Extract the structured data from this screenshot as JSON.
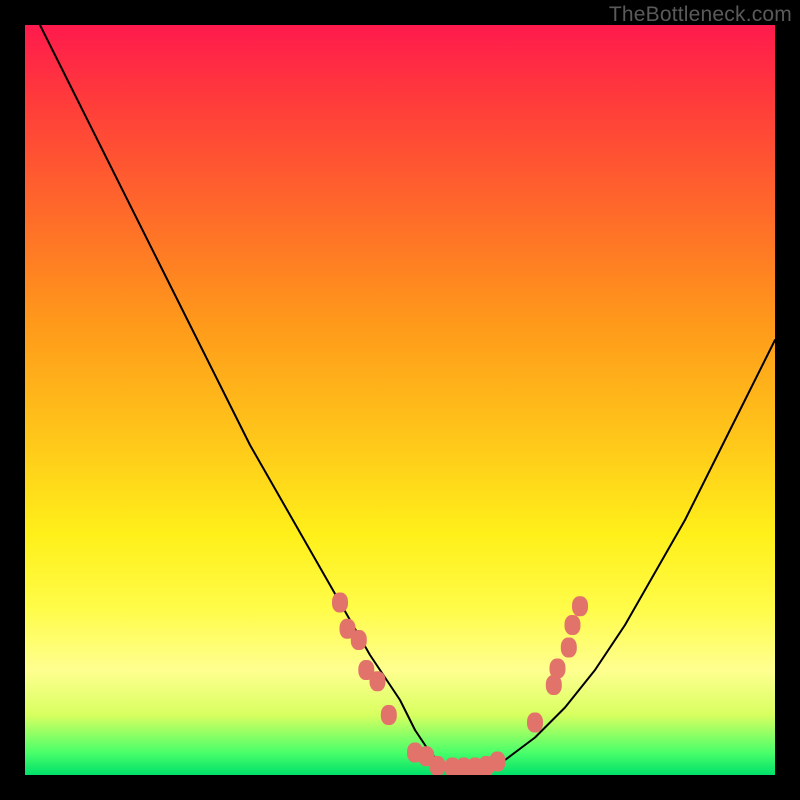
{
  "watermark": "TheBottleneck.com",
  "chart_data": {
    "type": "line",
    "title": "",
    "xlabel": "",
    "ylabel": "",
    "xlim": [
      0,
      100
    ],
    "ylim": [
      0,
      100
    ],
    "grid": false,
    "legend": false,
    "series": [
      {
        "name": "bottleneck-curve",
        "x": [
          2,
          6,
          10,
          14,
          18,
          22,
          26,
          30,
          34,
          38,
          42,
          46,
          50,
          52,
          54,
          56,
          58,
          60,
          64,
          68,
          72,
          76,
          80,
          84,
          88,
          92,
          96,
          100
        ],
        "values": [
          100,
          92,
          84,
          76,
          68,
          60,
          52,
          44,
          37,
          30,
          23,
          16,
          10,
          6,
          3,
          1,
          1,
          1,
          2,
          5,
          9,
          14,
          20,
          27,
          34,
          42,
          50,
          58
        ]
      }
    ],
    "markers": {
      "name": "highlight-points",
      "color": "#e2736b",
      "shape": "rounded-rect",
      "points": [
        {
          "x": 42.0,
          "y": 23.0
        },
        {
          "x": 43.0,
          "y": 19.5
        },
        {
          "x": 44.5,
          "y": 18.0
        },
        {
          "x": 45.5,
          "y": 14.0
        },
        {
          "x": 47.0,
          "y": 12.5
        },
        {
          "x": 48.5,
          "y": 8.0
        },
        {
          "x": 52.0,
          "y": 3.0
        },
        {
          "x": 53.5,
          "y": 2.5
        },
        {
          "x": 55.0,
          "y": 1.2
        },
        {
          "x": 57.0,
          "y": 1.0
        },
        {
          "x": 58.5,
          "y": 1.0
        },
        {
          "x": 60.0,
          "y": 1.0
        },
        {
          "x": 61.5,
          "y": 1.2
        },
        {
          "x": 63.0,
          "y": 1.8
        },
        {
          "x": 68.0,
          "y": 7.0
        },
        {
          "x": 70.5,
          "y": 12.0
        },
        {
          "x": 71.0,
          "y": 14.2
        },
        {
          "x": 72.5,
          "y": 17.0
        },
        {
          "x": 73.0,
          "y": 20.0
        },
        {
          "x": 74.0,
          "y": 22.5
        }
      ]
    }
  }
}
